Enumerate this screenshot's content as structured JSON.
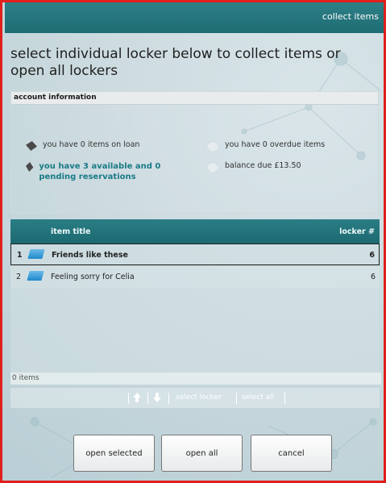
{
  "window": {
    "title": "collect items"
  },
  "heading": "select individual locker below to collect items or open all lockers",
  "account": {
    "header": "account information",
    "items_on_loan": "you have 0 items on loan",
    "overdue": "you have 0 overdue items",
    "reservations": "you have 3 available and 0 pending reservations",
    "balance": "balance due £13.50"
  },
  "table": {
    "columns": [
      "item title",
      "locker #"
    ],
    "rows": [
      {
        "num": "1",
        "title": "Friends like these",
        "locker": "6",
        "selected": true
      },
      {
        "num": "2",
        "title": "Feeling sorry for Celia",
        "locker": "6",
        "selected": false
      }
    ],
    "footer": "0 items"
  },
  "toolbar": {
    "select_locker": "select locker",
    "select_all": "select all"
  },
  "buttons": {
    "open_selected": "open selected",
    "open_all": "open all",
    "cancel": "cancel"
  },
  "colors": {
    "teal": "#1f6d74",
    "frame": "#e0201c",
    "highlight": "#1a7a86"
  }
}
